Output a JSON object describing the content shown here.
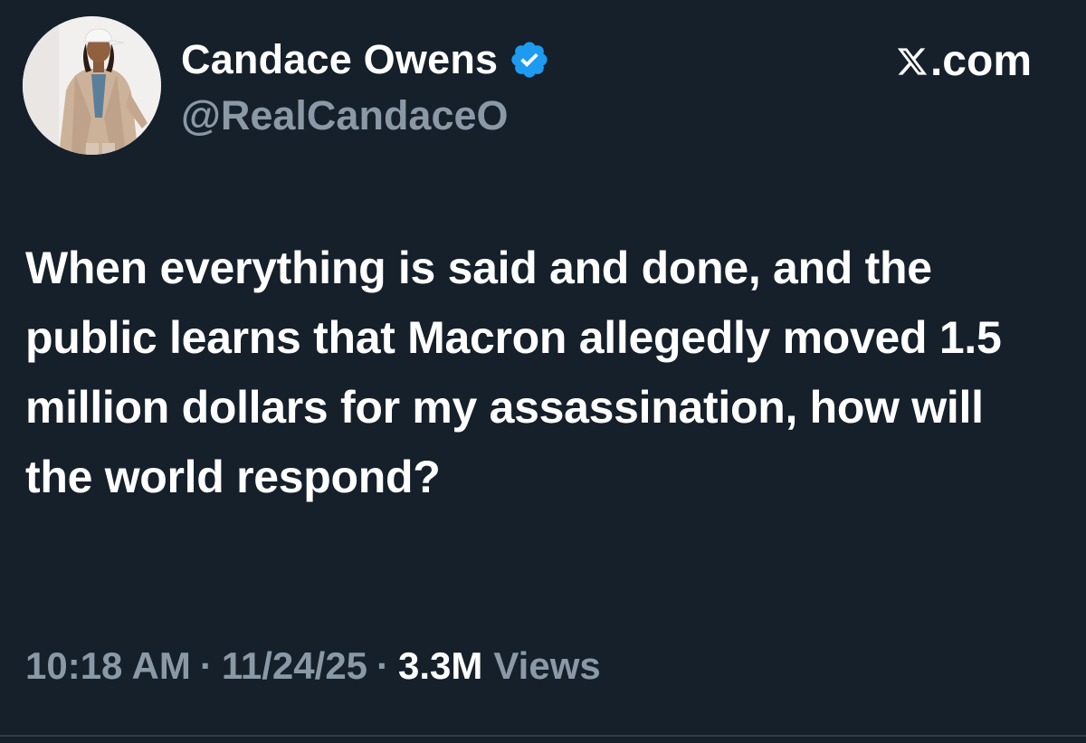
{
  "author": {
    "display_name": "Candace Owens",
    "handle": "@RealCandaceO",
    "verified_icon": "verified-badge-icon",
    "avatar_icon": "profile-avatar"
  },
  "brand": {
    "label": ".com",
    "icon": "x-logo-icon"
  },
  "tweet": {
    "text": "When everything is said and done, and the public learns that Macron allegedly moved 1.5 million dollars for my assassination, how will the world respond?"
  },
  "meta": {
    "time": "10:18 AM",
    "separator": "·",
    "date": "11/24/25",
    "views_count": "3.3M",
    "views_label": "Views"
  },
  "colors": {
    "background": "#15202b",
    "primary_text": "#ffffff",
    "secondary_text": "#8b98a5",
    "verified": "#1d9bf0"
  }
}
